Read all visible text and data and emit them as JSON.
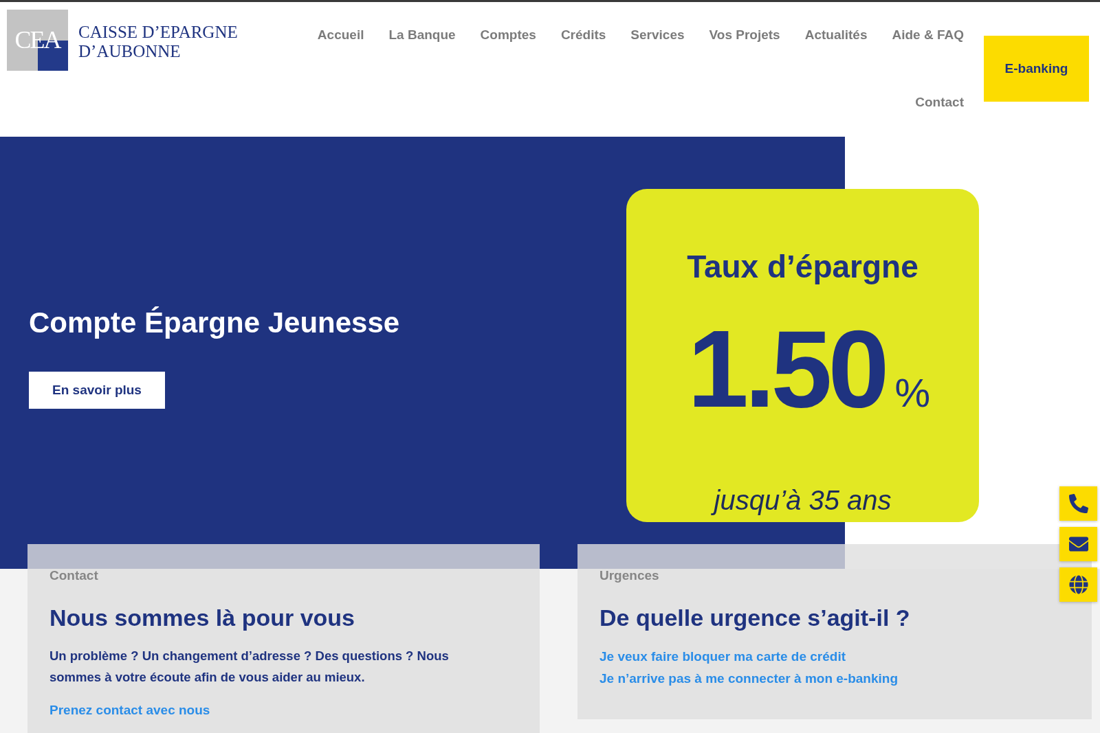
{
  "logo": {
    "mark": "CEA",
    "name_lines": [
      "CAISSE D’EPARGNE",
      "D’AUBONNE"
    ]
  },
  "nav": {
    "items": [
      "Accueil",
      "La Banque",
      "Comptes",
      "Crédits",
      "Services",
      "Vos Projets",
      "Actualités",
      "Aide & FAQ",
      "Contact"
    ],
    "cta": "E-banking"
  },
  "hero": {
    "title": "Compte Épargne Jeunesse",
    "button": "En savoir plus",
    "promo": {
      "title": "Taux d’épargne",
      "rate": "1.50",
      "unit": "%",
      "note": "jusqu’à 35 ans"
    }
  },
  "cards": [
    {
      "label": "Contact",
      "title": "Nous sommes là pour vous",
      "text": "Un problème ? Un changement d’adresse ? Des questions ? Nous sommes à votre écoute afin de vous aider au mieux.",
      "links": [
        "Prenez contact avec nous"
      ]
    },
    {
      "label": "Urgences",
      "title": "De quelle urgence s’agit-il ?",
      "links": [
        "Je veux faire bloquer ma carte de crédit",
        "Je n’arrive pas à me connecter à mon e-banking"
      ]
    }
  ]
}
